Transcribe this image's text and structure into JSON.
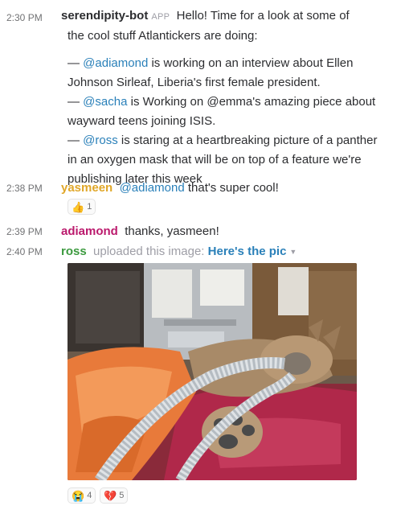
{
  "messages": {
    "bot": {
      "time": "2:30 PM",
      "author": "serendipity-bot",
      "badge": "APP",
      "intro_a": "Hello! Time for a look at some of",
      "intro_b": "the cool stuff Atlantickers are doing:",
      "item1": {
        "dash": "— ",
        "mention": "@adiamond",
        "text_a": " is working on an interview about Ellen",
        "text_b": "Johnson Sirleaf, Liberia's first female president."
      },
      "item2": {
        "dash": "— ",
        "mention": "@sacha",
        "text_a": " is Working on @emma's amazing piece about",
        "text_b": "wayward teens joining ISIS."
      },
      "item3": {
        "dash": "— ",
        "mention": "@ross",
        "text_a": " is staring at a heartbreaking picture of a panther",
        "text_b": "in an oxygen mask that will be on top of a feature we're",
        "text_c": "publishing later this week"
      }
    },
    "yasmeen": {
      "time": "2:38 PM",
      "author": "yasmeen",
      "mention": "@adiamond",
      "text": " that's super cool!",
      "reaction": {
        "emoji": "👍",
        "count": "1"
      }
    },
    "adiamond": {
      "time": "2:39 PM",
      "author": "adiamond",
      "text": "thanks, yasmeen!"
    },
    "ross": {
      "time": "2:40 PM",
      "author": "ross",
      "uploaded_text": "uploaded this image:",
      "file_title": "Here's the pic",
      "reactions": [
        {
          "emoji": "😭",
          "count": "4"
        },
        {
          "emoji": "💔",
          "count": "5"
        }
      ]
    }
  },
  "colors": {
    "bot_author": "#2c2d30",
    "yasmeen": "#e0a729",
    "adiamond": "#bb1a6d",
    "ross": "#3c9a3f",
    "mention": "#2a80b9"
  }
}
